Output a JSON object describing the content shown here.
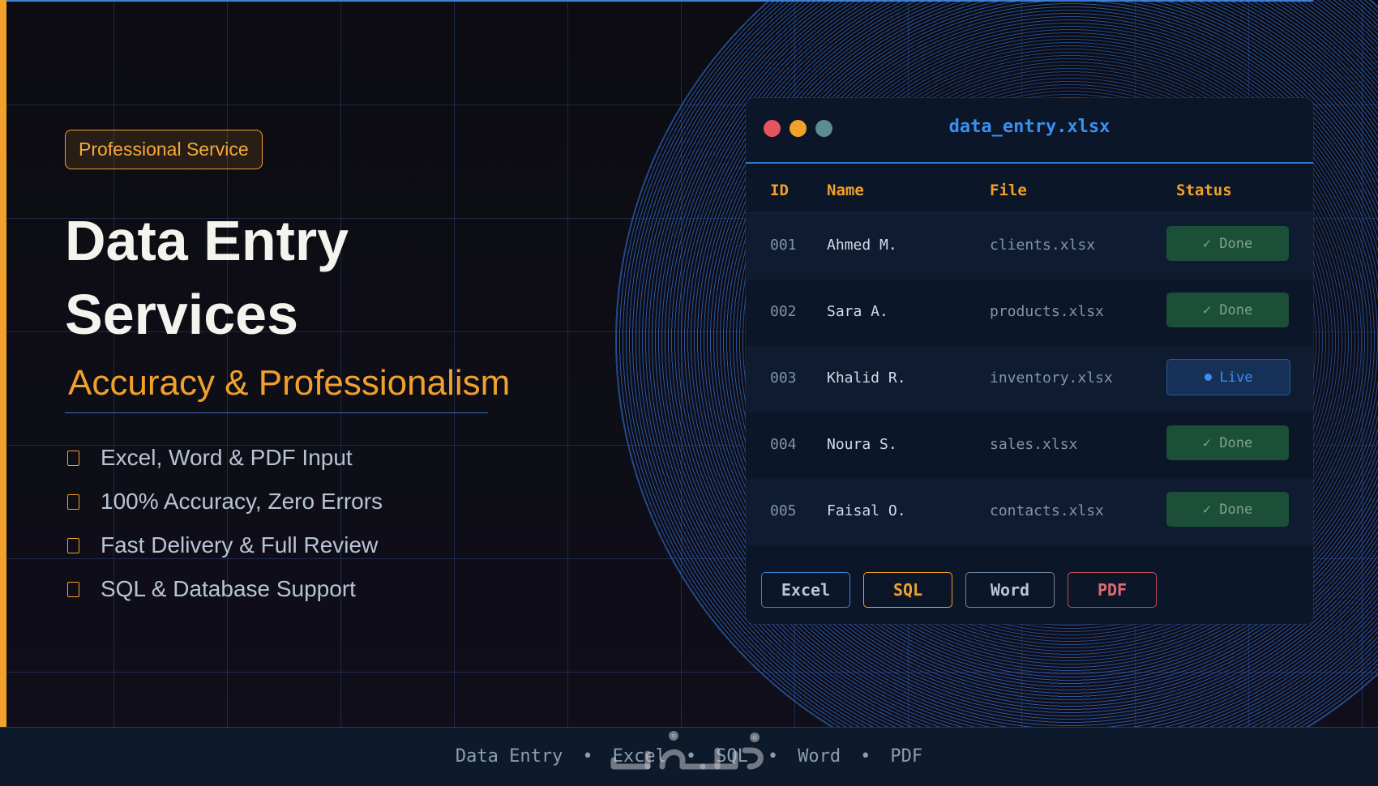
{
  "hero": {
    "badge": "Professional Service",
    "title_line1": "Data Entry",
    "title_line2": "Services",
    "subtitle": "Accuracy & Professionalism",
    "features": [
      "Excel, Word & PDF Input",
      "100% Accuracy, Zero Errors",
      "Fast Delivery & Full Review",
      "SQL & Database Support"
    ]
  },
  "window": {
    "title": "data_entry.xlsx",
    "columns": [
      "ID",
      "Name",
      "File",
      "Status"
    ],
    "rows": [
      {
        "id": "001",
        "name": "Ahmed M.",
        "file": "clients.xlsx",
        "status": "✓ Done"
      },
      {
        "id": "002",
        "name": "Sara A.",
        "file": "products.xlsx",
        "status": "✓ Done"
      },
      {
        "id": "003",
        "name": "Khalid R.",
        "file": "inventory.xlsx",
        "status": "Live"
      },
      {
        "id": "004",
        "name": "Noura S.",
        "file": "sales.xlsx",
        "status": "✓ Done"
      },
      {
        "id": "005",
        "name": "Faisal O.",
        "file": "contacts.xlsx",
        "status": "✓ Done"
      }
    ],
    "tags": [
      "Excel",
      "SQL",
      "Word",
      "PDF"
    ]
  },
  "footer": {
    "items": [
      "Data Entry",
      "Excel",
      "SQL",
      "Word",
      "PDF"
    ],
    "separator": "•"
  },
  "watermark": {
    "text": "خمسات"
  },
  "colors": {
    "accent_orange": "#f2a02c",
    "accent_blue": "#3b84d6",
    "background": "#0c0c12",
    "window_bg": "#0b1628",
    "done_green": "#1b4f38",
    "pdf_red": "#c4505a"
  },
  "icons": [
    "checkbox-icon",
    "window-close-dot",
    "window-minimize-dot",
    "window-maximize-dot",
    "live-dot-icon"
  ]
}
